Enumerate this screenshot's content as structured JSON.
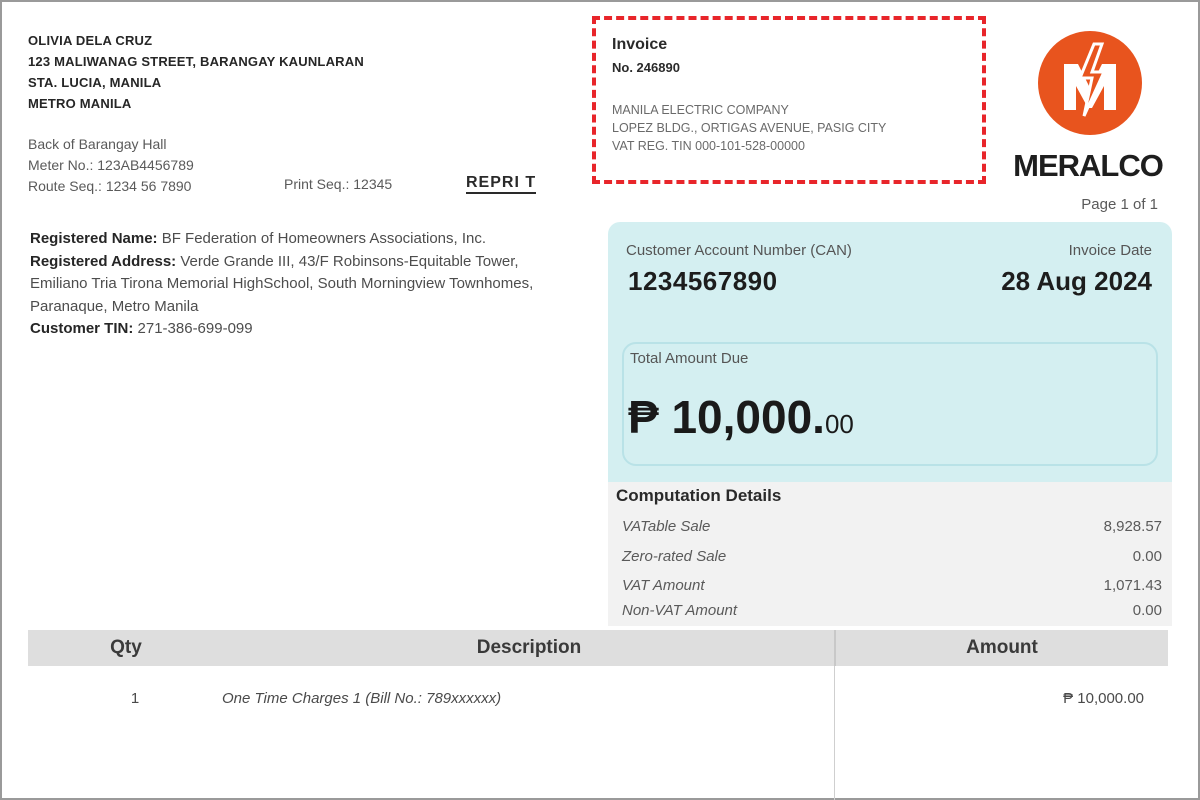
{
  "customer": {
    "name": "OLIVIA DELA CRUZ",
    "address_lines": [
      "123 MALIWANAG STREET, BARANGAY KAUNLARAN",
      "STA. LUCIA, MANILA",
      "METRO MANILA"
    ]
  },
  "meter": {
    "location": "Back of Barangay Hall",
    "meter_no": "Meter No.: 123AB4456789",
    "route_seq": "Route Seq.: 1234 56 7890",
    "print_seq": "Print Seq.: 12345",
    "reprint": "REPRI T"
  },
  "registration": {
    "name_label": "Registered Name:",
    "name_value": "BF Federation of Homeowners Associations, Inc.",
    "address_label": "Registered Address:",
    "address_value": "Verde Grande III, 43/F Robinsons-Equitable Tower, Emiliano Tria Tirona Memorial HighSchool, South Morningview Townhomes, Paranaque, Metro Manila",
    "tin_label": "Customer TIN:",
    "tin_value": "271-386-699-099"
  },
  "issuer": {
    "title": "Invoice",
    "number": "No. 246890",
    "lines": [
      "MANILA ELECTRIC COMPANY",
      "LOPEZ BLDG., ORTIGAS AVENUE, PASIG CITY",
      "VAT REG. TIN 000-101-528-00000"
    ],
    "border_color": "#e8252a"
  },
  "logo": {
    "text": "MERALCO",
    "icon": "meralco-logo-icon",
    "color": "#e8541e"
  },
  "page_count": "Page 1 of 1",
  "account": {
    "can_label": "Customer Account Number (CAN)",
    "can_value": "1234567890",
    "date_label": "Invoice Date",
    "date_value": "28 Aug 2024",
    "panel_color": "#d4eff1"
  },
  "total": {
    "label": "Total Amount Due",
    "amount": "₱ 10,000.",
    "cents": "00"
  },
  "computation": {
    "title": "Computation Details",
    "rows": [
      {
        "label": "VATable Sale",
        "value": "8,928.57"
      },
      {
        "label": "Zero-rated Sale",
        "value": "0.00"
      },
      {
        "label": "VAT Amount",
        "value": "1,071.43"
      },
      {
        "label": "Non-VAT Amount",
        "value": "0.00"
      }
    ]
  },
  "table": {
    "headers": {
      "qty": "Qty",
      "description": "Description",
      "amount": "Amount"
    },
    "rows": [
      {
        "qty": "1",
        "description": "One Time Charges 1 (Bill No.: 789xxxxxx)",
        "amount": "₱ 10,000.00"
      }
    ]
  }
}
